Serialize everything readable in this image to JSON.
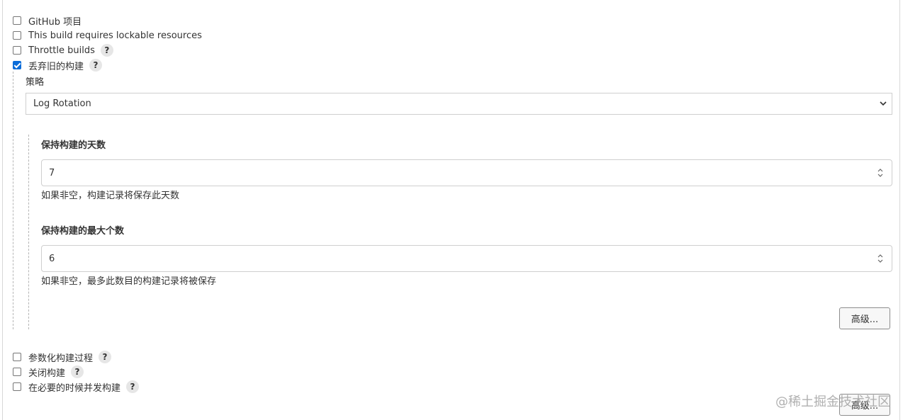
{
  "options": [
    {
      "label": "GitHub 项目",
      "checked": false,
      "help": ""
    },
    {
      "label": "This build requires lockable resources",
      "checked": false,
      "help": ""
    },
    {
      "label": "Throttle builds",
      "checked": false,
      "help": "?"
    },
    {
      "label": "丢弃旧的构建",
      "checked": true,
      "help": "?"
    }
  ],
  "discard": {
    "strategy_label": "策略",
    "strategy_value": "Log Rotation",
    "days_label": "保持构建的天数",
    "days_value": "7",
    "days_hint": "如果非空，构建记录将保存此天数",
    "max_label": "保持构建的最大个数",
    "max_value": "6",
    "max_hint": "如果非空，最多此数目的构建记录将被保存",
    "advanced_button": "高级..."
  },
  "more_options": [
    {
      "label": "参数化构建过程",
      "checked": false,
      "help": "?"
    },
    {
      "label": "关闭构建",
      "checked": false,
      "help": "?"
    },
    {
      "label": "在必要的时候并发构建",
      "checked": false,
      "help": "?"
    }
  ],
  "footer": {
    "advanced_button": "高级...",
    "watermark": "@稀土掘金技术社区"
  },
  "colors": {
    "checkbox_checked": "#0a6cd9"
  },
  "icons": {
    "select_arrow": "chevron-down-icon",
    "spinner": "spinner-arrows-icon"
  }
}
